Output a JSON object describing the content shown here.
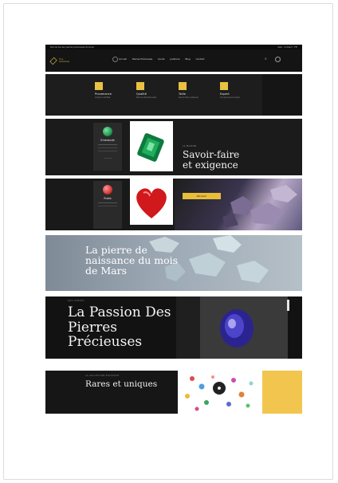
{
  "header": {
    "topbar_left": "Découvrez les pierres précieuses du mois",
    "topbar_right": "Aide · Contact · FR",
    "logo_line1": "Vos",
    "logo_line2": "Gemmes",
    "nav": [
      "Accueil",
      "Pierres Précieuses",
      "Guide",
      "Joaillerie",
      "Blog",
      "Contact"
    ]
  },
  "features": {
    "items": [
      {
        "label": "Provenance",
        "sub": "Origine certifiée"
      },
      {
        "label": "Qualité",
        "sub": "Pierres sélectionnées"
      },
      {
        "label": "Taille",
        "sub": "Savoir-faire artisanal"
      },
      {
        "label": "Expert",
        "sub": "Conseil personnalisé"
      }
    ]
  },
  "savoir": {
    "card_name": "Emeraude",
    "kicker": "LA MAISON",
    "title_line1": "Savoir-faire",
    "title_line2": "et exigence"
  },
  "ruby": {
    "card_name": "Rubis",
    "button": "Découvrir"
  },
  "birthstone": {
    "title_line1": "La pierre de",
    "title_line2": "naissance du mois",
    "title_line3": "de Mars"
  },
  "passion": {
    "kicker": "NOS GEMMES",
    "title_line1": "La Passion Des",
    "title_line2": "Pierres",
    "title_line3": "Précieuses"
  },
  "rares": {
    "kicker": "LA COLLECTION EXCLUSIVE",
    "title": "Rares et uniques"
  },
  "colors": {
    "gold": "#e9c143",
    "dark": "#1b1b1b",
    "emerald": "#1f9d55",
    "ruby": "#d83838",
    "sapphire": "#3a2fa4"
  }
}
